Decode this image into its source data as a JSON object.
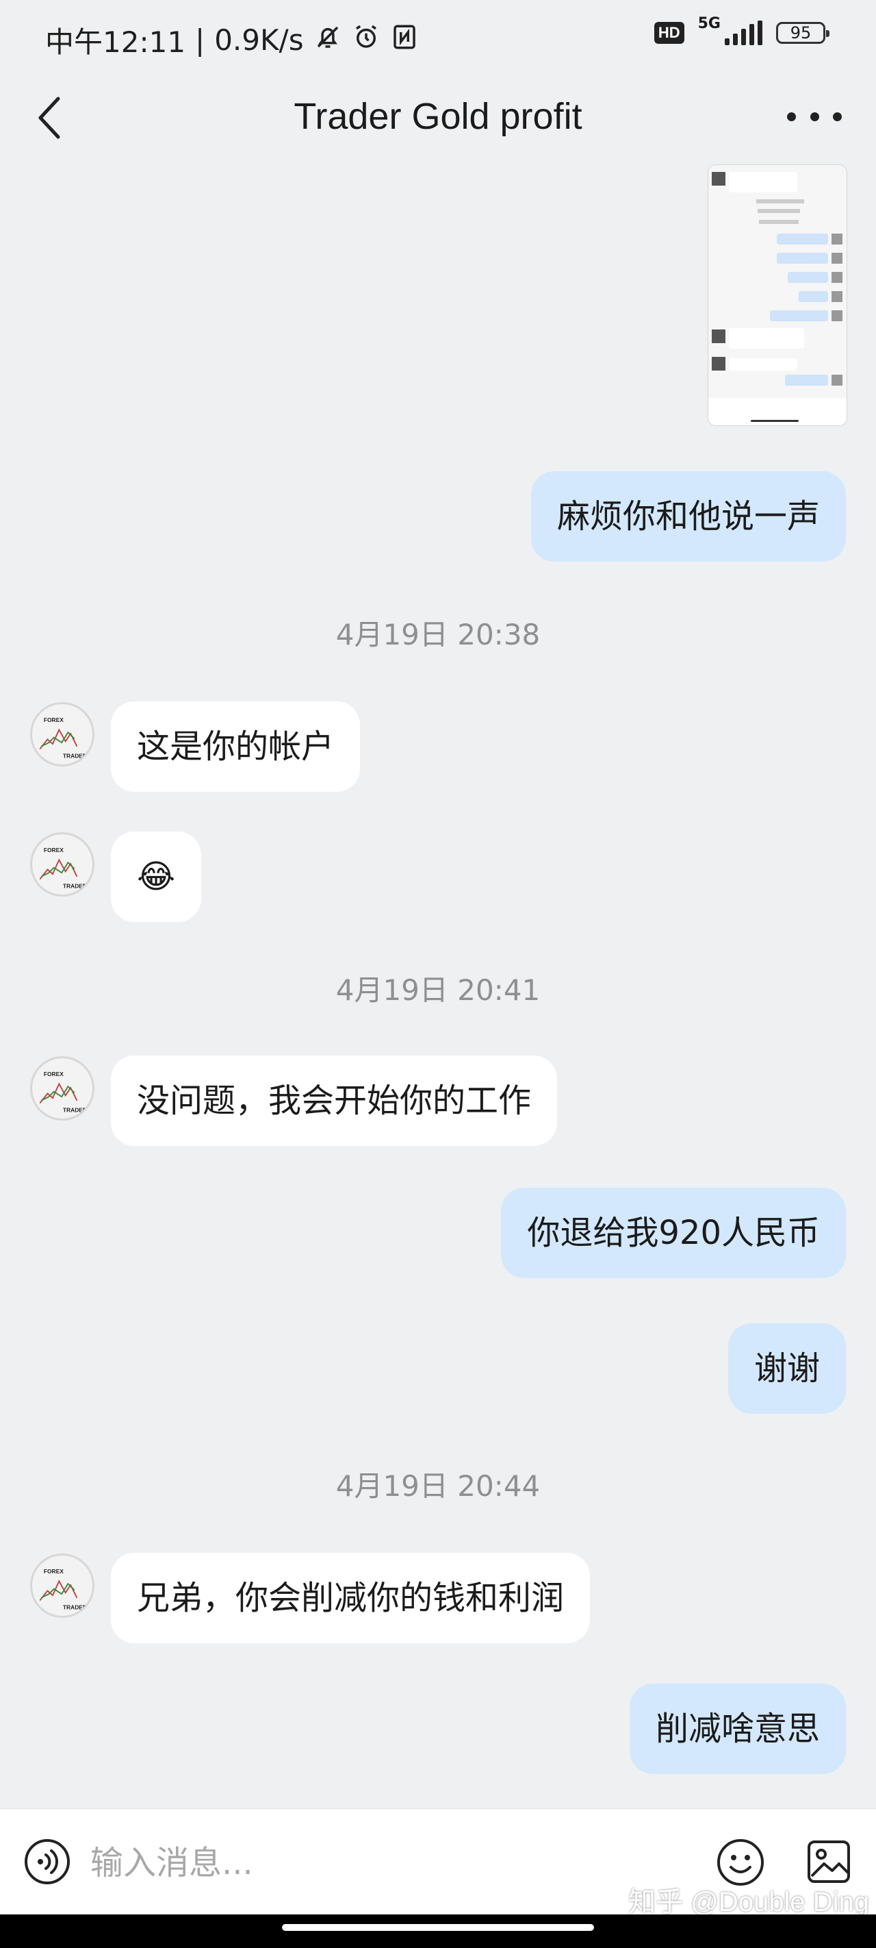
{
  "status_bar": {
    "time": "中午12:11",
    "network_speed": "0.9K/s",
    "hd_label": "HD",
    "network_type": "5G",
    "battery": "95",
    "icons": [
      "bell-off-icon",
      "alarm-icon",
      "nfc-icon",
      "signal-icon",
      "battery-icon"
    ]
  },
  "header": {
    "title": "Trader Gold profit",
    "back_icon": "chevron-left-icon",
    "more_icon": "more-horizontal-icon"
  },
  "messages": [
    {
      "type": "image",
      "sender": "me"
    },
    {
      "type": "text",
      "sender": "me",
      "text": "麻烦你和他说一声"
    },
    {
      "type": "time",
      "text": "4月19日 20:38"
    },
    {
      "type": "text",
      "sender": "other",
      "text": "这是你的帐户"
    },
    {
      "type": "text",
      "sender": "other",
      "text": "😂"
    },
    {
      "type": "time",
      "text": "4月19日 20:41"
    },
    {
      "type": "text",
      "sender": "other",
      "text": "没问题，我会开始你的工作"
    },
    {
      "type": "text",
      "sender": "me",
      "text": "你退给我920人民币"
    },
    {
      "type": "text",
      "sender": "me",
      "text": "谢谢"
    },
    {
      "type": "time",
      "text": "4月19日 20:44"
    },
    {
      "type": "text",
      "sender": "other",
      "text": "兄弟，你会削减你的钱和利润"
    },
    {
      "type": "text",
      "sender": "me",
      "text": "削减啥意思"
    }
  ],
  "avatar": {
    "line1": "FOREX",
    "line2": "TRADER"
  },
  "input_bar": {
    "placeholder": "输入消息...",
    "voice_icon": "voice-icon",
    "emoji_icon": "emoji-icon",
    "image_icon": "image-icon"
  },
  "watermark": "知乎 @Double Ding",
  "colors": {
    "background": "#eff0f2",
    "incoming_bubble": "#ffffff",
    "outgoing_bubble": "#d3e8fc",
    "timestamp_text": "#8d8f92"
  }
}
